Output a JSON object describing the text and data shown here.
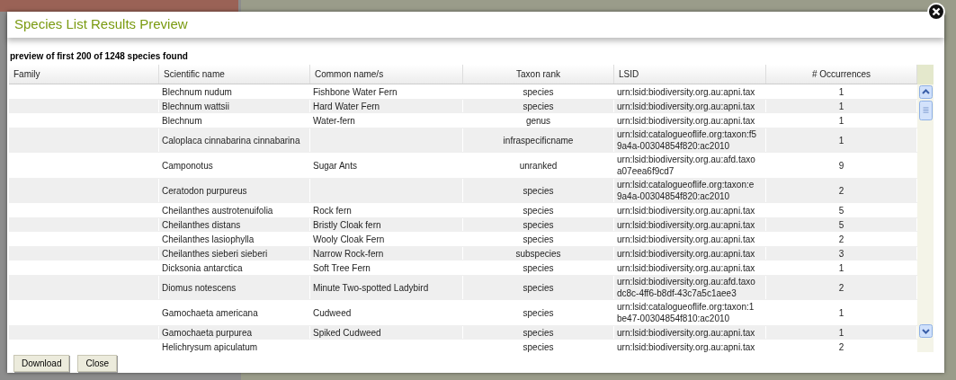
{
  "dialog": {
    "title": "Species List Results Preview",
    "summary": "preview of first 200 of 1248 species found"
  },
  "table": {
    "columns": [
      "Family",
      "Scientific name",
      "Common name/s",
      "Taxon rank",
      "LSID",
      "# Occurrences"
    ],
    "rows": [
      {
        "family": "",
        "scientific_name": "Blechnum nudum",
        "common_names": "Fishbone Water Fern",
        "taxon_rank": "species",
        "lsid": [
          "urn:lsid:biodiversity.org.au:apni.tax"
        ],
        "occurrences": "1"
      },
      {
        "family": "",
        "scientific_name": "Blechnum wattsii",
        "common_names": "Hard Water Fern",
        "taxon_rank": "species",
        "lsid": [
          "urn:lsid:biodiversity.org.au:apni.tax"
        ],
        "occurrences": "1"
      },
      {
        "family": "",
        "scientific_name": "Blechnum",
        "common_names": "Water-fern",
        "taxon_rank": "genus",
        "lsid": [
          "urn:lsid:biodiversity.org.au:apni.tax"
        ],
        "occurrences": "1"
      },
      {
        "family": "",
        "scientific_name": "Caloplaca cinnabarina cinnabarina",
        "common_names": "",
        "taxon_rank": "infraspecificname",
        "lsid": [
          "urn:lsid:catalogueoflife.org:taxon:f5",
          "9a4a-00304854f820:ac2010"
        ],
        "occurrences": "1"
      },
      {
        "family": "",
        "scientific_name": "Camponotus",
        "common_names": "Sugar Ants",
        "taxon_rank": "unranked",
        "lsid": [
          "urn:lsid:biodiversity.org.au:afd.taxo",
          "a07eea6f9cd7"
        ],
        "occurrences": "9"
      },
      {
        "family": "",
        "scientific_name": "Ceratodon purpureus",
        "common_names": "",
        "taxon_rank": "species",
        "lsid": [
          "urn:lsid:catalogueoflife.org:taxon:e",
          "9a4a-00304854f820:ac2010"
        ],
        "occurrences": "2"
      },
      {
        "family": "",
        "scientific_name": "Cheilanthes austrotenuifolia",
        "common_names": "Rock fern",
        "taxon_rank": "species",
        "lsid": [
          "urn:lsid:biodiversity.org.au:apni.tax"
        ],
        "occurrences": "5"
      },
      {
        "family": "",
        "scientific_name": "Cheilanthes distans",
        "common_names": "Bristly Cloak fern",
        "taxon_rank": "species",
        "lsid": [
          "urn:lsid:biodiversity.org.au:apni.tax"
        ],
        "occurrences": "5"
      },
      {
        "family": "",
        "scientific_name": "Cheilanthes lasiophylla",
        "common_names": "Wooly Cloak Fern",
        "taxon_rank": "species",
        "lsid": [
          "urn:lsid:biodiversity.org.au:apni.tax"
        ],
        "occurrences": "2"
      },
      {
        "family": "",
        "scientific_name": "Cheilanthes sieberi sieberi",
        "common_names": "Narrow Rock-fern",
        "taxon_rank": "subspecies",
        "lsid": [
          "urn:lsid:biodiversity.org.au:apni.tax"
        ],
        "occurrences": "3"
      },
      {
        "family": "",
        "scientific_name": "Dicksonia antarctica",
        "common_names": "Soft Tree Fern",
        "taxon_rank": "species",
        "lsid": [
          "urn:lsid:biodiversity.org.au:apni.tax"
        ],
        "occurrences": "1"
      },
      {
        "family": "",
        "scientific_name": "Diomus notescens",
        "common_names": "Minute Two-spotted Ladybird",
        "taxon_rank": "species",
        "lsid": [
          "urn:lsid:biodiversity.org.au:afd.taxo",
          "dc8c-4ff6-b8df-43c7a5c1aee3"
        ],
        "occurrences": "2"
      },
      {
        "family": "",
        "scientific_name": "Gamochaeta americana",
        "common_names": "Cudweed",
        "taxon_rank": "species",
        "lsid": [
          "urn:lsid:catalogueoflife.org:taxon:1",
          "be47-00304854f810:ac2010"
        ],
        "occurrences": "1"
      },
      {
        "family": "",
        "scientific_name": "Gamochaeta purpurea",
        "common_names": "Spiked Cudweed",
        "taxon_rank": "species",
        "lsid": [
          "urn:lsid:biodiversity.org.au:apni.tax"
        ],
        "occurrences": "1"
      },
      {
        "family": "",
        "scientific_name": "Helichrysum apiculatum",
        "common_names": "",
        "taxon_rank": "species",
        "lsid": [
          "urn:lsid:biodiversity.org.au:apni.tax"
        ],
        "occurrences": "2"
      }
    ]
  },
  "buttons": [
    "Download",
    "Close"
  ]
}
